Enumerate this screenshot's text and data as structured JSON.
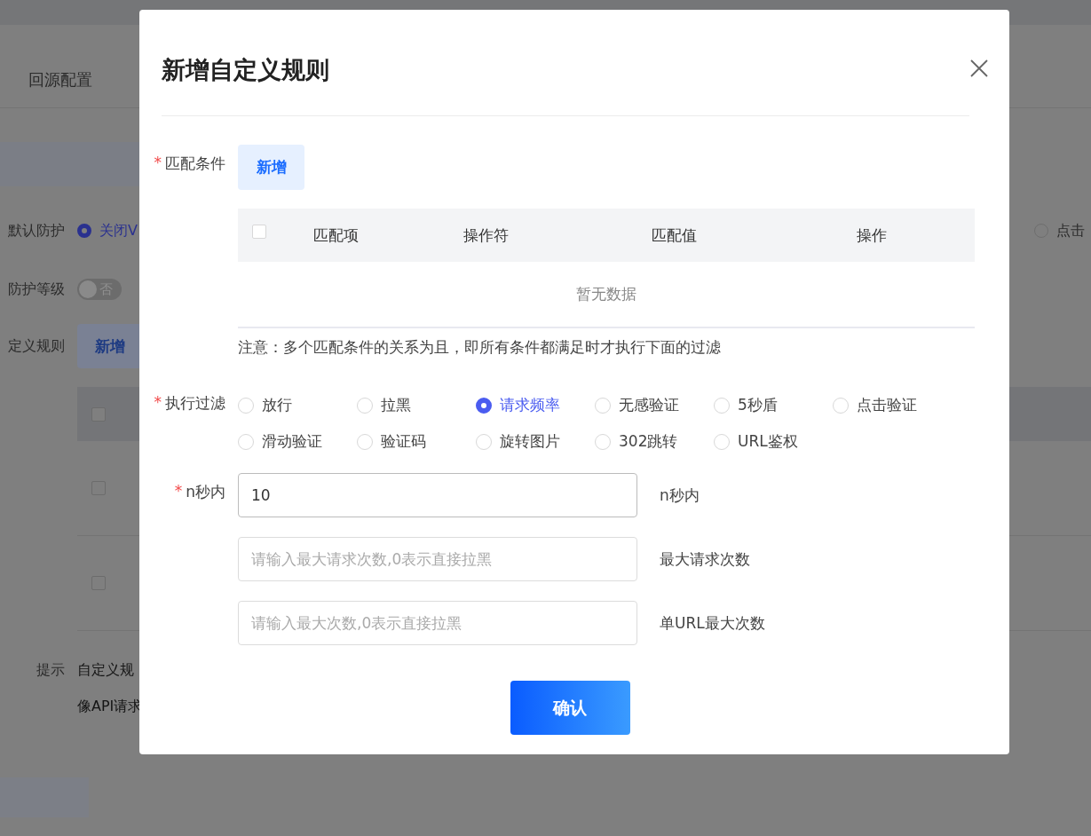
{
  "background": {
    "tab": "回源配置",
    "default_protection": {
      "label": "默认防护",
      "options": [
        {
          "label": "关闭V",
          "selected": true
        },
        {
          "label": "点击",
          "selected": false
        }
      ]
    },
    "level": {
      "label": "防护等级",
      "on": false,
      "toggle_text": "否"
    },
    "rules": {
      "label": "定义规则",
      "add_button": "新增",
      "header_checked": false,
      "rows": [
        {
          "checked": false
        },
        {
          "checked": false
        }
      ]
    },
    "tip": {
      "label": "提示",
      "lines": [
        "自定义规",
        "像API请求"
      ]
    }
  },
  "dialog": {
    "title": "新增自定义规则",
    "match_conditions": {
      "required_mark": "*",
      "label": "匹配条件",
      "add_button": "新增",
      "select_all_checked": false,
      "columns": [
        "匹配项",
        "操作符",
        "匹配值",
        "操作"
      ],
      "empty_text": "暂无数据",
      "note": "注意：多个匹配条件的关系为且，即所有条件都满足时才执行下面的过滤"
    },
    "filter": {
      "required_mark": "*",
      "label": "执行过滤",
      "options": [
        {
          "label": "放行",
          "selected": false
        },
        {
          "label": "拉黑",
          "selected": false
        },
        {
          "label": "请求频率",
          "selected": true
        },
        {
          "label": "无感验证",
          "selected": false
        },
        {
          "label": "5秒盾",
          "selected": false
        },
        {
          "label": "点击验证",
          "selected": false
        },
        {
          "label": "滑动验证",
          "selected": false
        },
        {
          "label": "验证码",
          "selected": false
        },
        {
          "label": "旋转图片",
          "selected": false
        },
        {
          "label": "302跳转",
          "selected": false
        },
        {
          "label": "URL鉴权",
          "selected": false
        }
      ]
    },
    "fields": [
      {
        "required_mark": "*",
        "label": "n秒内",
        "value": "10",
        "side_label": "n秒内"
      },
      {
        "placeholder": "请输入最大请求次数,0表示直接拉黑",
        "side_label": "最大请求次数"
      },
      {
        "placeholder": "请输入最大次数,0表示直接拉黑",
        "side_label": "单URL最大次数"
      }
    ],
    "confirm_button": "确认"
  }
}
